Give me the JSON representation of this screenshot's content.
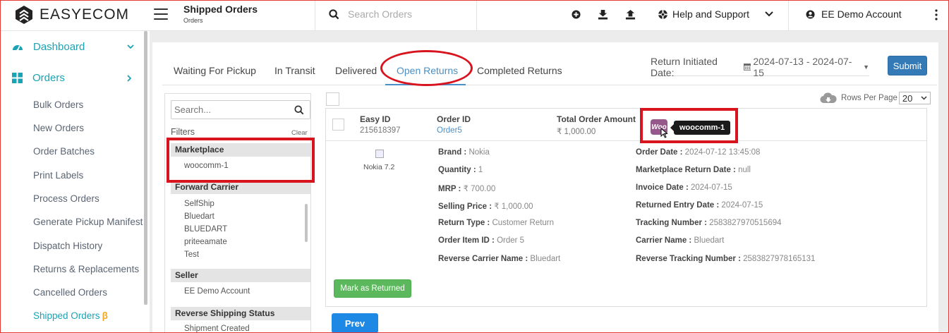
{
  "brand": {
    "name": "EASYECOM"
  },
  "header": {
    "title": "Shipped Orders",
    "subtitle": "Orders",
    "search_placeholder": "Search Orders",
    "help_label": "Help and Support",
    "account_label": "EE Demo Account"
  },
  "sidebar": {
    "main": [
      {
        "label": "Dashboard",
        "icon": "dashboard-gauge-icon"
      },
      {
        "label": "Orders",
        "icon": "grid-icon"
      }
    ],
    "sub": [
      "Bulk Orders",
      "New Orders",
      "Order Batches",
      "Print Labels",
      "Process Orders",
      "Generate Pickup Manifest",
      "Dispatch History",
      "Returns & Replacements",
      "Cancelled Orders",
      "Shipped Orders"
    ],
    "active_badge": "β"
  },
  "tabs": [
    "Waiting For Pickup",
    "In Transit",
    "Delivered",
    "Open Returns",
    "Completed Returns"
  ],
  "active_tab": "Open Returns",
  "date_filter": {
    "label": "Return Initiated Date:",
    "value": "2024-07-13 - 2024-07-15"
  },
  "submit_label": "Submit",
  "filters": {
    "search_placeholder": "Search...",
    "title": "Filters",
    "clear": "Clear",
    "groups": [
      {
        "title": "Marketplace",
        "items": [
          "woocomm-1"
        ]
      },
      {
        "title": "Forward Carrier",
        "items": [
          "SelfShip",
          "Bluedart",
          "BLUEDART",
          "priteeamate",
          "Test"
        ]
      },
      {
        "title": "Seller",
        "items": [
          "EE Demo Account"
        ]
      },
      {
        "title": "Reverse Shipping Status",
        "items": [
          "Shipment Created"
        ]
      }
    ]
  },
  "rows_per_page": {
    "label": "Rows Per Page",
    "value": "20"
  },
  "order": {
    "easy_id_label": "Easy ID",
    "easy_id": "215618397",
    "order_id_label": "Order ID",
    "order_id": "Order5",
    "total_label": "Total Order Amount",
    "total": "₹ 1,000.00",
    "marketplace_logo": "Woo",
    "marketplace_tooltip": "woocomm-1",
    "product_name": "Nokia 7.2",
    "left_details": [
      {
        "label": "Brand :",
        "value": "Nokia"
      },
      {
        "label": "Quantity :",
        "value": "1"
      },
      {
        "label": "MRP :",
        "value": "₹ 700.00"
      },
      {
        "label": "Selling Price :",
        "value": "₹ 1,000.00"
      },
      {
        "label": "Return Type :",
        "value": "Customer Return"
      },
      {
        "label": "Order Item ID :",
        "value": "Order 5"
      },
      {
        "label": "Reverse Carrier Name :",
        "value": "Bluedart"
      }
    ],
    "right_details": [
      {
        "label": "Order Date :",
        "value": "2024-07-12 13:45:08"
      },
      {
        "label": "Marketplace Return Date :",
        "value": "null"
      },
      {
        "label": "Invoice Date :",
        "value": "2024-07-15"
      },
      {
        "label": "Returned Entry Date :",
        "value": "2024-07-15"
      },
      {
        "label": "Tracking Number :",
        "value": "2583827970515694"
      },
      {
        "label": "Carrier Name :",
        "value": "Bluedart"
      },
      {
        "label": "Reverse Tracking Number :",
        "value": "2583827978165131"
      }
    ],
    "mark_returned_label": "Mark as Returned"
  },
  "prev_label": "Prev",
  "colors": {
    "accent": "#1aa3b5",
    "tab_active": "#4a90c7",
    "highlight": "#d8141f",
    "submit": "#337ab7",
    "success": "#5cb85c",
    "woo": "#96588a"
  }
}
